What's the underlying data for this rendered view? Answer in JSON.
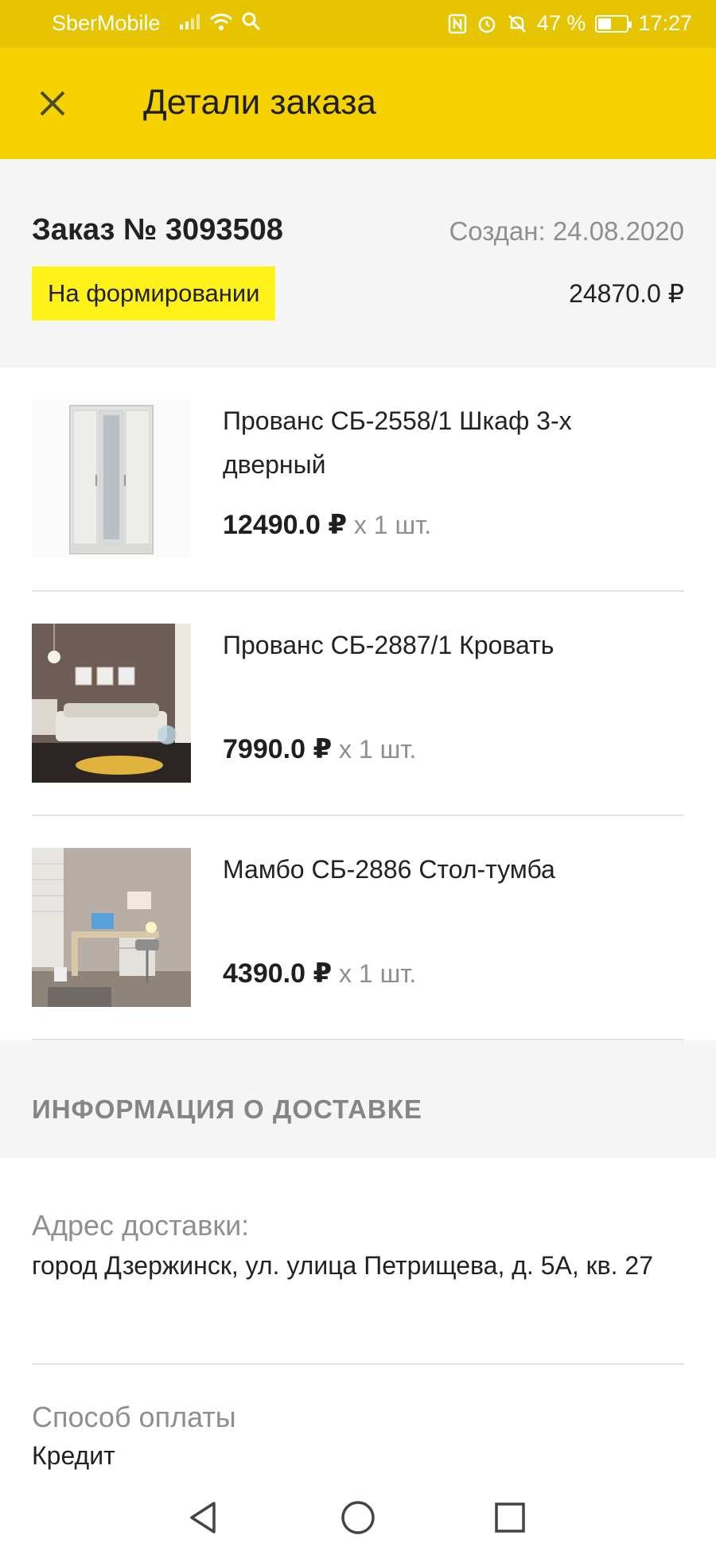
{
  "status_bar": {
    "carrier": "SberMobile",
    "battery": "47 %",
    "battery_level": 0.47,
    "time": "17:27"
  },
  "app_bar": {
    "title": "Детали заказа",
    "close_icon": "close-icon"
  },
  "order": {
    "number": "Заказ № 3093508",
    "created": "Создан: 24.08.2020",
    "status": "На формировании",
    "total": "24870.0 ₽"
  },
  "items": [
    {
      "name": "Прованс СБ-2558/1 Шкаф 3-х дверный",
      "price": "12490.0 ₽",
      "qty": " х 1 шт."
    },
    {
      "name": "Прованс СБ-2887/1 Кровать",
      "price": "7990.0 ₽",
      "qty": " х 1 шт."
    },
    {
      "name": "Мамбо СБ-2886 Стол-тумба",
      "price": "4390.0 ₽",
      "qty": " х 1 шт."
    }
  ],
  "delivery": {
    "heading": "ИНФОРМАЦИЯ О ДОСТАВКЕ",
    "address_label": "Адрес доставки:",
    "address_value": "город Дзержинск, ул. улица Петрищева, д. 5А, кв. 27",
    "payment_label": "Способ оплаты",
    "payment_value": "Кредит"
  },
  "nav_bar": {
    "back_icon": "back-icon",
    "home_icon": "home-icon",
    "recents_icon": "recents-icon"
  }
}
